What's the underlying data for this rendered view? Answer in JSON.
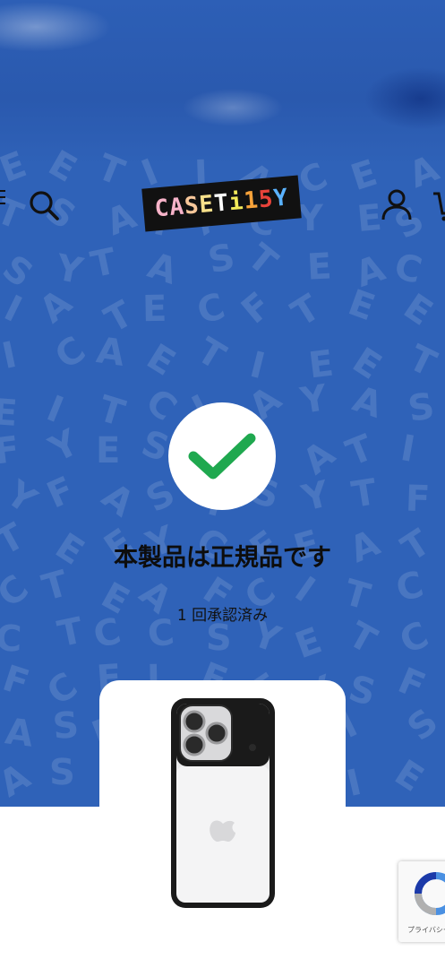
{
  "header": {
    "logo_letters": [
      {
        "char": "C",
        "color": "#f7b3c9"
      },
      {
        "char": "A",
        "color": "#f7b3c9"
      },
      {
        "char": "S",
        "color": "#f7c79a"
      },
      {
        "char": "E",
        "color": "#f7e08a"
      },
      {
        "char": "T",
        "color": "#ffffff"
      },
      {
        "char": "i",
        "color": "#f2ea5a"
      },
      {
        "char": "1",
        "color": "#f7a23a"
      },
      {
        "char": "5",
        "color": "#e8433a"
      },
      {
        "char": "Y",
        "color": "#5ab2ff"
      }
    ],
    "icons": {
      "menu": "menu-icon",
      "search": "search-icon",
      "account": "account-icon",
      "cart": "cart-icon"
    }
  },
  "verification": {
    "title": "本製品は正規品です",
    "count": "1 回承認済み",
    "icon": "check-icon",
    "check_color": "#1fa84f"
  },
  "recaptcha": {
    "label": "プライバシー"
  },
  "colors": {
    "hero_blue": "#2f62b8",
    "page_bg": "#ffffff"
  }
}
